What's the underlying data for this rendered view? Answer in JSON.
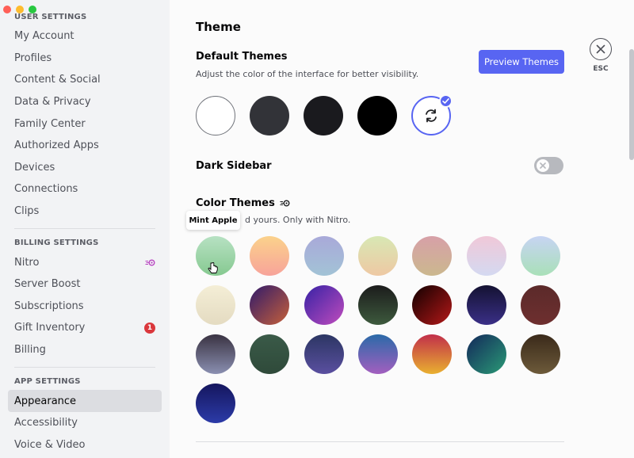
{
  "window": {
    "controls": [
      "#ff5f57",
      "#febc2e",
      "#28c840"
    ]
  },
  "sidebar": {
    "sections": [
      {
        "header": "USER SETTINGS",
        "items": [
          {
            "label": "My Account"
          },
          {
            "label": "Profiles"
          },
          {
            "label": "Content & Social"
          },
          {
            "label": "Data & Privacy"
          },
          {
            "label": "Family Center"
          },
          {
            "label": "Authorized Apps"
          },
          {
            "label": "Devices"
          },
          {
            "label": "Connections"
          },
          {
            "label": "Clips"
          }
        ]
      },
      {
        "header": "BILLING SETTINGS",
        "items": [
          {
            "label": "Nitro",
            "icon": "nitro-icon"
          },
          {
            "label": "Server Boost"
          },
          {
            "label": "Subscriptions"
          },
          {
            "label": "Gift Inventory",
            "badge": "1"
          },
          {
            "label": "Billing"
          }
        ]
      },
      {
        "header": "APP SETTINGS",
        "items": [
          {
            "label": "Appearance",
            "active": true
          },
          {
            "label": "Accessibility"
          },
          {
            "label": "Voice & Video"
          }
        ]
      }
    ]
  },
  "main": {
    "title": "Theme",
    "default_themes": {
      "heading": "Default Themes",
      "description": "Adjust the color of the interface for better visibility.",
      "preview_button": "Preview Themes",
      "options": [
        {
          "name": "light",
          "color": "#ffffff"
        },
        {
          "name": "ash",
          "color": "#323338"
        },
        {
          "name": "dark",
          "color": "#1a1a1e"
        },
        {
          "name": "onyx",
          "color": "#000000"
        },
        {
          "name": "sync-with-computer",
          "icon": "sync-icon",
          "selected": true
        }
      ]
    },
    "esc": {
      "label": "ESC",
      "icon": "close-icon"
    },
    "dark_sidebar": {
      "label": "Dark Sidebar",
      "enabled": false
    },
    "color_themes": {
      "heading": "Color Themes",
      "icon": "nitro-icon",
      "description_visible": "d yours. Only with Nitro.",
      "tooltip": "Mint Apple",
      "swatches": [
        {
          "gradient": "linear-gradient(180deg,#b7e1c3,#86c990)"
        },
        {
          "gradient": "linear-gradient(180deg,#fbd28b,#f7a39a)"
        },
        {
          "gradient": "linear-gradient(180deg,#a9a9d9,#a2c3d6)"
        },
        {
          "gradient": "linear-gradient(180deg,#d8e8b4,#eec8a3)"
        },
        {
          "gradient": "linear-gradient(180deg,#d7a0a8,#cbb88e)"
        },
        {
          "gradient": "linear-gradient(180deg,#f0c8d8,#d4d9f1)"
        },
        {
          "gradient": "linear-gradient(180deg,#c7d4f3,#a9e0b8)"
        },
        {
          "gradient": "linear-gradient(180deg,#f4eed6,#e4dbc1)"
        },
        {
          "gradient": "linear-gradient(135deg,#301a6b,#c6603a)"
        },
        {
          "gradient": "linear-gradient(135deg,#3722a5,#c04cbd)"
        },
        {
          "gradient": "linear-gradient(180deg,#1c1c1c,#3d5a3d)"
        },
        {
          "gradient": "linear-gradient(135deg,#110000,#b51818)"
        },
        {
          "gradient": "linear-gradient(180deg,#141232,#3a2f87)"
        },
        {
          "gradient": "linear-gradient(180deg,#5b2a2a,#6e2f2f)"
        },
        {
          "gradient": "linear-gradient(180deg,#3a3342,#8a8fb1)"
        },
        {
          "gradient": "linear-gradient(180deg,#3a5a48,#2f4a3a)"
        },
        {
          "gradient": "linear-gradient(180deg,#2c3663,#5a4fa0)"
        },
        {
          "gradient": "linear-gradient(180deg,#2b6aa8,#a35fbf)"
        },
        {
          "gradient": "linear-gradient(180deg,#c12f4a,#e9b030)"
        },
        {
          "gradient": "linear-gradient(135deg,#13285a,#2a9a76)"
        },
        {
          "gradient": "linear-gradient(180deg,#3a2a1a,#6d5a3a)"
        },
        {
          "gradient": "linear-gradient(180deg,#15165e,#2c3ba8)"
        }
      ]
    }
  }
}
